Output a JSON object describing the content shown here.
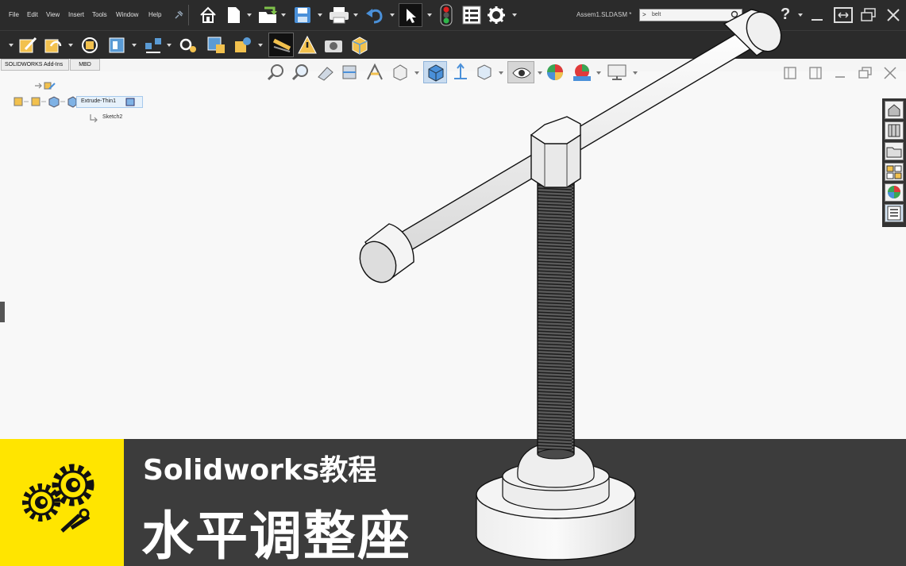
{
  "menu": {
    "file": "File",
    "edit": "Edit",
    "view": "View",
    "insert": "Insert",
    "tools": "Tools",
    "window": "Window",
    "help": "Help"
  },
  "toolbar": {
    "icons": [
      "home-icon",
      "new-document-icon",
      "open-icon",
      "save-icon",
      "print-icon",
      "undo-icon",
      "select-pointer-icon",
      "rebuild-icon",
      "file-properties-icon",
      "options-gear-icon"
    ]
  },
  "window": {
    "title": "Assem1.SLDASM *"
  },
  "search": {
    "prompt": ">",
    "value": "belt"
  },
  "help_glyph": "?",
  "tabs": {
    "addins": "SOLIDWORKS Add-Ins",
    "mbd": "MBD"
  },
  "tree": {
    "feature": "Extrude-Thin1",
    "sketch": "Sketch2"
  },
  "banner": {
    "subtitle": "Solidworks教程",
    "title": "水平调整座"
  },
  "colors": {
    "toolbar_bg": "#2b2b2b",
    "banner_bg": "#3c3c3c",
    "logo_yellow": "#ffe500",
    "viewport_bg": "#f8f8f8"
  }
}
